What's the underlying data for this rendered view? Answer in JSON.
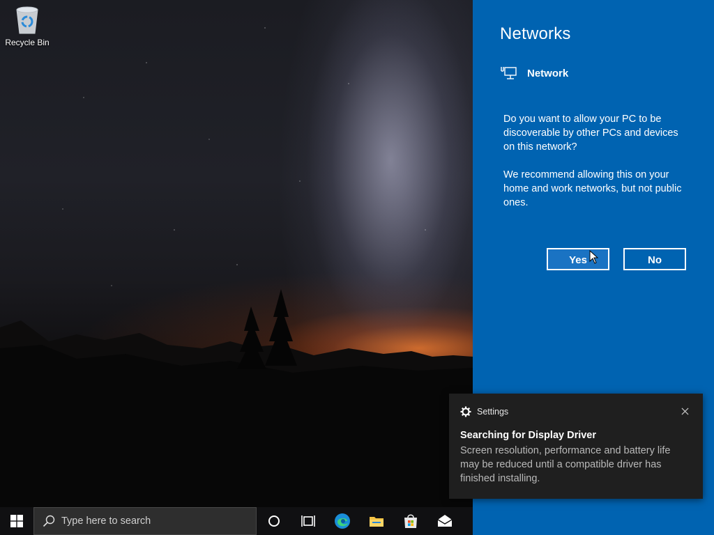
{
  "desktop": {
    "recycle_bin_label": "Recycle Bin"
  },
  "network_flyout": {
    "title": "Networks",
    "network_name": "Network",
    "question": "Do you want to allow your PC to be discoverable by other PCs and devices on this network?",
    "recommendation": "We recommend allowing this on your home and work networks, but not public ones.",
    "yes_label": "Yes",
    "no_label": "No",
    "accent_color": "#0063b1"
  },
  "toast": {
    "app_name": "Settings",
    "title": "Searching for Display Driver",
    "body": "Screen resolution, performance and battery life may be reduced until a compatible driver has finished installing."
  },
  "taskbar": {
    "search_placeholder": "Type here to search",
    "icons": [
      "windows-start-icon",
      "search-icon",
      "cortana-icon",
      "task-view-icon",
      "edge-icon",
      "file-explorer-icon",
      "microsoft-store-icon",
      "mail-icon"
    ]
  }
}
